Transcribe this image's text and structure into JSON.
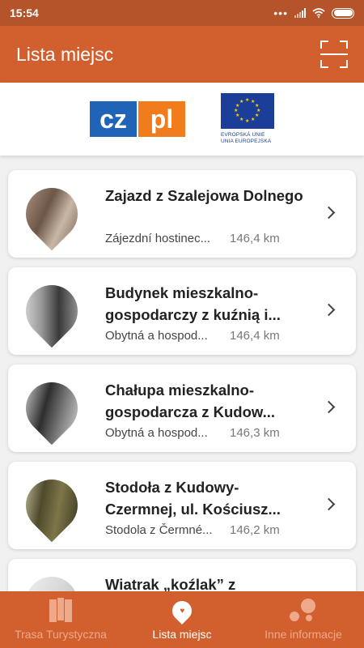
{
  "status": {
    "time": "15:54",
    "dots": "•••"
  },
  "header": {
    "title": "Lista miejsc"
  },
  "logos": {
    "eu_line1": "EVROPSKÁ UNIE",
    "eu_line2": "UNIA EUROPEJSKA",
    "czpl_cz": "cz",
    "czpl_pl": "pl"
  },
  "places": [
    {
      "title": "Zajazd z Szalejowa Dolnego",
      "subtitle": "Zájezdní hostinec...",
      "distance": "146,4 km",
      "icon": "photo-sepia"
    },
    {
      "title": "Budynek mieszkalno-gospodarczy z kuźnią i...",
      "subtitle": "Obytná a hospod...",
      "distance": "146,4 km",
      "icon": "photo-bw"
    },
    {
      "title": "Chałupa mieszkalno-gospodarcza z Kudow...",
      "subtitle": "Obytná a hospod...",
      "distance": "146,3 km",
      "icon": "photo-bw"
    },
    {
      "title": "Stodoła z Kudowy-Czermnej, ul. Kościusz...",
      "subtitle": "Stodola z Čermné...",
      "distance": "146,2 km",
      "icon": "photo-green"
    },
    {
      "title": "Wiatrak „koźlak” z",
      "subtitle": "",
      "distance": "",
      "icon": "photo-light"
    }
  ],
  "nav": [
    {
      "label": "Trasa Turystyczna",
      "icon": "map-icon"
    },
    {
      "label": "Lista miejsc",
      "icon": "location-pin-icon"
    },
    {
      "label": "Inne informacje",
      "icon": "dots-icon"
    }
  ],
  "colors": {
    "primary": "#d2602f",
    "status_bar": "#b5532a",
    "nav_inactive": "#eea98a"
  }
}
